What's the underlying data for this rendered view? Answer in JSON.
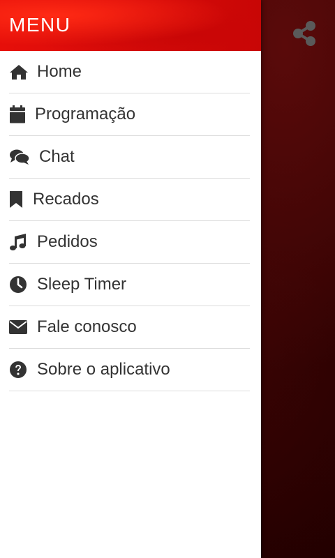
{
  "drawer": {
    "title": "MENU",
    "items": [
      {
        "label": "Home",
        "icon": "home-icon"
      },
      {
        "label": "Programação",
        "icon": "calendar-icon"
      },
      {
        "label": "Chat",
        "icon": "chat-icon"
      },
      {
        "label": "Recados",
        "icon": "bookmark-icon"
      },
      {
        "label": "Pedidos",
        "icon": "music-note-icon"
      },
      {
        "label": "Sleep Timer",
        "icon": "clock-icon"
      },
      {
        "label": "Fale conosco",
        "icon": "envelope-icon"
      },
      {
        "label": "Sobre o aplicativo",
        "icon": "question-circle-icon"
      }
    ]
  },
  "toolbar": {
    "share_icon": "share-icon"
  },
  "colors": {
    "header_red": "#e10e0a",
    "icon_gray": "#333333",
    "backdrop_dark_red": "#2a0000",
    "share_icon_gray": "#5a5a5a"
  }
}
